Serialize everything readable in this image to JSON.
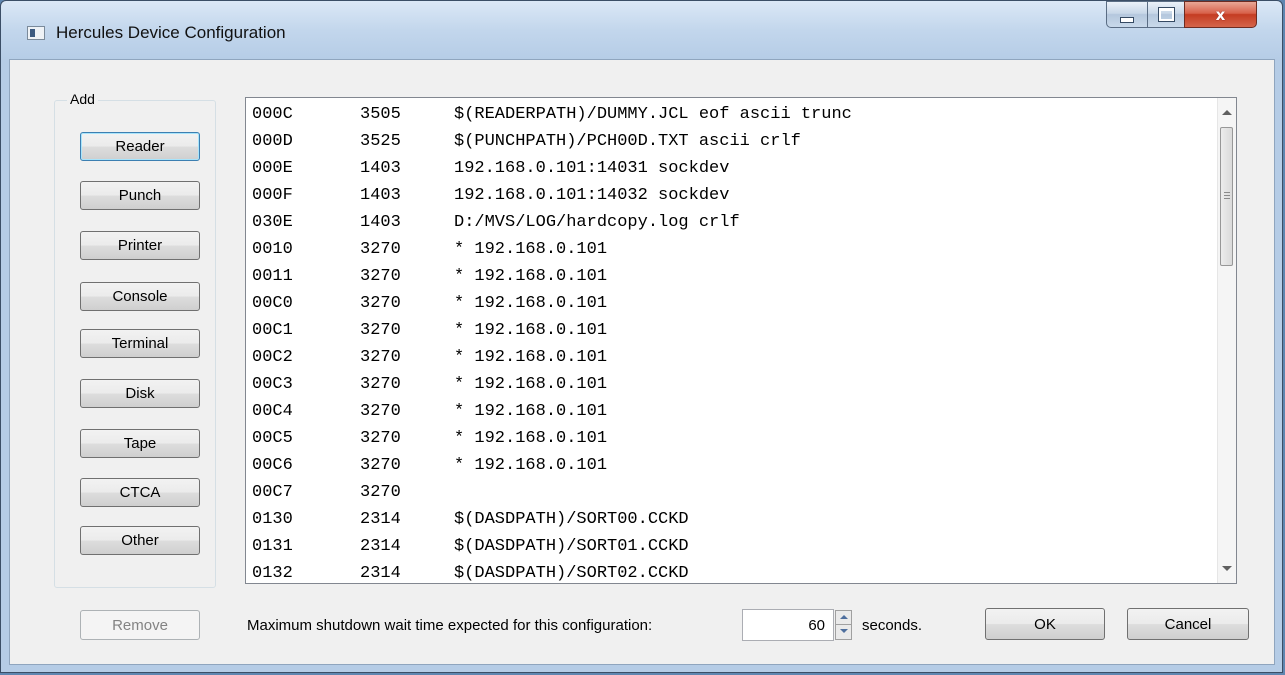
{
  "window": {
    "title": "Hercules Device Configuration",
    "close_glyph": "x"
  },
  "add_group": {
    "label": "Add",
    "buttons": [
      "Reader",
      "Punch",
      "Printer",
      "Console",
      "Terminal",
      "Disk",
      "Tape",
      "CTCA",
      "Other"
    ]
  },
  "devices": [
    {
      "addr": "000C",
      "type": "3505",
      "args": "$(READERPATH)/DUMMY.JCL eof ascii trunc"
    },
    {
      "addr": "000D",
      "type": "3525",
      "args": "$(PUNCHPATH)/PCH00D.TXT ascii crlf"
    },
    {
      "addr": "000E",
      "type": "1403",
      "args": "192.168.0.101:14031 sockdev"
    },
    {
      "addr": "000F",
      "type": "1403",
      "args": "192.168.0.101:14032 sockdev"
    },
    {
      "addr": "030E",
      "type": "1403",
      "args": "D:/MVS/LOG/hardcopy.log crlf"
    },
    {
      "addr": "0010",
      "type": "3270",
      "args": "* 192.168.0.101"
    },
    {
      "addr": "0011",
      "type": "3270",
      "args": "* 192.168.0.101"
    },
    {
      "addr": "00C0",
      "type": "3270",
      "args": "* 192.168.0.101"
    },
    {
      "addr": "00C1",
      "type": "3270",
      "args": "* 192.168.0.101"
    },
    {
      "addr": "00C2",
      "type": "3270",
      "args": "* 192.168.0.101"
    },
    {
      "addr": "00C3",
      "type": "3270",
      "args": "* 192.168.0.101"
    },
    {
      "addr": "00C4",
      "type": "3270",
      "args": "* 192.168.0.101"
    },
    {
      "addr": "00C5",
      "type": "3270",
      "args": "* 192.168.0.101"
    },
    {
      "addr": "00C6",
      "type": "3270",
      "args": "* 192.168.0.101"
    },
    {
      "addr": "00C7",
      "type": "3270",
      "args": ""
    },
    {
      "addr": "0130",
      "type": "2314",
      "args": "$(DASDPATH)/SORT00.CCKD"
    },
    {
      "addr": "0131",
      "type": "2314",
      "args": "$(DASDPATH)/SORT01.CCKD"
    },
    {
      "addr": "0132",
      "type": "2314",
      "args": "$(DASDPATH)/SORT02.CCKD"
    }
  ],
  "footer": {
    "remove_label": "Remove",
    "shutdown_label": "Maximum shutdown wait time expected for this configuration:",
    "wait_value": "60",
    "seconds_label": "seconds.",
    "ok_label": "OK",
    "cancel_label": "Cancel"
  }
}
